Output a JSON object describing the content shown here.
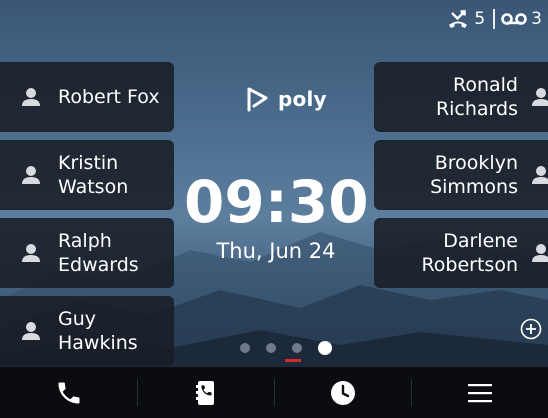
{
  "status": {
    "missed_calls": "5",
    "voicemails": "3"
  },
  "logo": {
    "brand": "poly"
  },
  "clock": {
    "time": "09:30",
    "date": "Thu, Jun 24"
  },
  "contacts_left": [
    {
      "name": "Robert Fox"
    },
    {
      "name": "Kristin Watson"
    },
    {
      "name": "Ralph Edwards"
    },
    {
      "name": "Guy Hawkins"
    }
  ],
  "contacts_right": [
    {
      "name": "Ronald Richards"
    },
    {
      "name": "Brooklyn Simmons"
    },
    {
      "name": "Darlene Robertson"
    }
  ],
  "pagination": {
    "pages": 4,
    "active_index": 3
  },
  "bottom_bar": {
    "items": [
      {
        "icon": "phone-icon"
      },
      {
        "icon": "directory-icon"
      },
      {
        "icon": "recent-calls-icon"
      },
      {
        "icon": "menu-icon"
      }
    ]
  },
  "colors": {
    "accent": "#d32a2a",
    "tile": "#181e26",
    "bar": "#0a0c10"
  }
}
